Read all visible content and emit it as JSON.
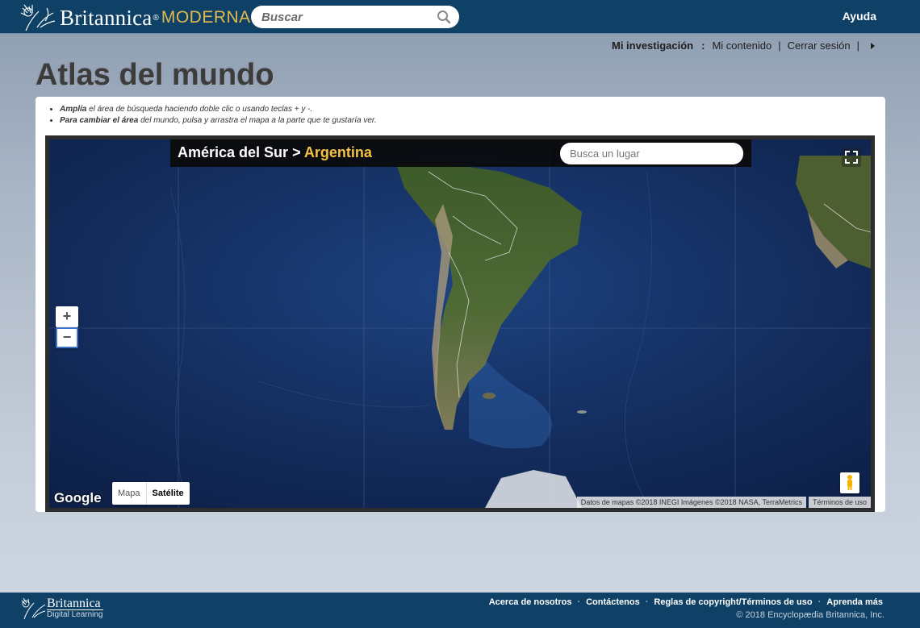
{
  "header": {
    "brand": "Britannica",
    "brand_mark": "®",
    "product": "MODERNA",
    "search_placeholder": "Buscar",
    "help": "Ayuda"
  },
  "userbar": {
    "research_label": "Mi investigación",
    "colon": ":",
    "my_content": "Mi contenido",
    "separator": "|",
    "logout": "Cerrar sesión"
  },
  "page": {
    "title": "Atlas del mundo",
    "tips": [
      {
        "bold": "Amplía",
        "rest": " el área de búsqueda haciendo doble clic o usando teclas + y -."
      },
      {
        "bold": "Para cambiar el área",
        "rest": " del mundo, pulsa y arrastra el mapa a la parte que te gustaría ver."
      }
    ]
  },
  "map": {
    "breadcrumb_parent": "América del Sur",
    "breadcrumb_sep": " > ",
    "breadcrumb_current": "Argentina",
    "place_placeholder": "Busca un lugar",
    "zoom_in": "+",
    "zoom_out": "−",
    "type_map": "Mapa",
    "type_satellite": "Satélite",
    "provider": "Google",
    "attribution": "Datos de mapas ©2018 INEGI Imágenes ©2018 NASA, TerraMetrics",
    "terms": "Términos de uso"
  },
  "footer": {
    "brand": "Britannica",
    "tagline": "Digital Learning",
    "links": [
      "Acerca de nosotros",
      "Contáctenos",
      "Reglas de copyright/Términos de uso",
      "Aprenda más"
    ],
    "copyright": "© 2018 Encyclopædia Britannica, Inc."
  }
}
